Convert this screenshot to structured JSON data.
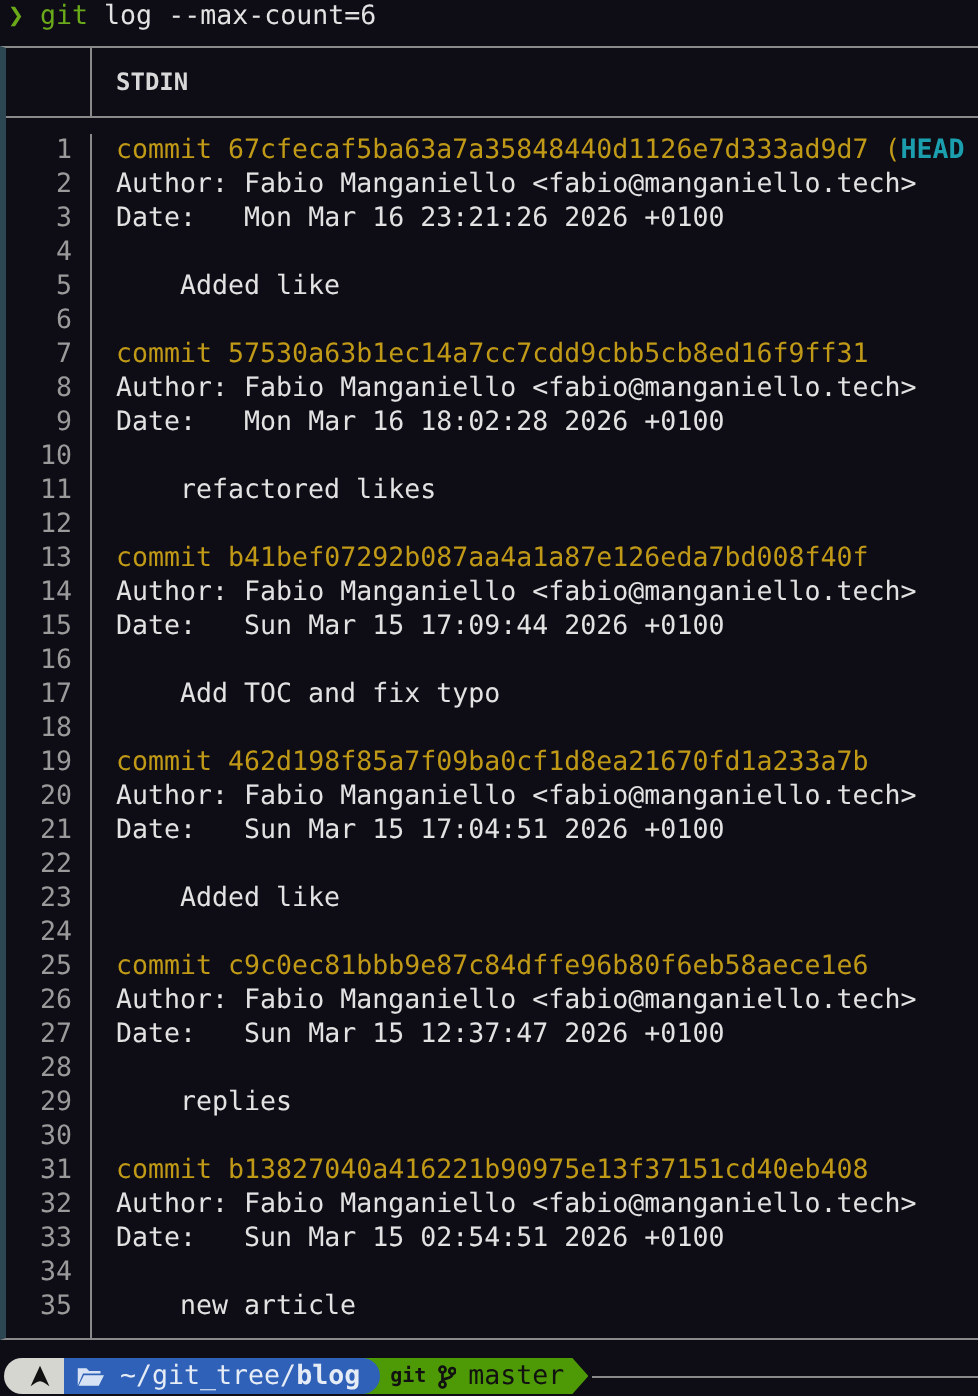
{
  "prompt": {
    "symbol": "❯",
    "command": "git",
    "args": "log --max-count=6"
  },
  "pager": {
    "header": "STDIN",
    "lines": [
      {
        "number": "1",
        "kind": "commit",
        "text": "commit 67cfecaf5ba63a7a35848440d1126e7d333ad9d7 (",
        "head": "HEAD"
      },
      {
        "number": "2",
        "kind": "author",
        "text": "Author: Fabio Manganiello <fabio@manganiello.tech>"
      },
      {
        "number": "3",
        "kind": "date",
        "text": "Date:   Mon Mar 16 23:21:26 2026 +0100"
      },
      {
        "number": "4",
        "kind": "blank"
      },
      {
        "number": "5",
        "kind": "message",
        "text": "Added like"
      },
      {
        "number": "6",
        "kind": "blank"
      },
      {
        "number": "7",
        "kind": "commit",
        "text": "commit 57530a63b1ec14a7cc7cdd9cbb5cb8ed16f9ff31"
      },
      {
        "number": "8",
        "kind": "author",
        "text": "Author: Fabio Manganiello <fabio@manganiello.tech>"
      },
      {
        "number": "9",
        "kind": "date",
        "text": "Date:   Mon Mar 16 18:02:28 2026 +0100"
      },
      {
        "number": "10",
        "kind": "blank"
      },
      {
        "number": "11",
        "kind": "message",
        "text": "refactored likes"
      },
      {
        "number": "12",
        "kind": "blank"
      },
      {
        "number": "13",
        "kind": "commit",
        "text": "commit b41bef07292b087aa4a1a87e126eda7bd008f40f"
      },
      {
        "number": "14",
        "kind": "author",
        "text": "Author: Fabio Manganiello <fabio@manganiello.tech>"
      },
      {
        "number": "15",
        "kind": "date",
        "text": "Date:   Sun Mar 15 17:09:44 2026 +0100"
      },
      {
        "number": "16",
        "kind": "blank"
      },
      {
        "number": "17",
        "kind": "message",
        "text": "Add TOC and fix typo"
      },
      {
        "number": "18",
        "kind": "blank"
      },
      {
        "number": "19",
        "kind": "commit",
        "text": "commit 462d198f85a7f09ba0cf1d8ea21670fd1a233a7b"
      },
      {
        "number": "20",
        "kind": "author",
        "text": "Author: Fabio Manganiello <fabio@manganiello.tech>"
      },
      {
        "number": "21",
        "kind": "date",
        "text": "Date:   Sun Mar 15 17:04:51 2026 +0100"
      },
      {
        "number": "22",
        "kind": "blank"
      },
      {
        "number": "23",
        "kind": "message",
        "text": "Added like"
      },
      {
        "number": "24",
        "kind": "blank"
      },
      {
        "number": "25",
        "kind": "commit",
        "text": "commit c9c0ec81bbb9e87c84dffe96b80f6eb58aece1e6"
      },
      {
        "number": "26",
        "kind": "author",
        "text": "Author: Fabio Manganiello <fabio@manganiello.tech>"
      },
      {
        "number": "27",
        "kind": "date",
        "text": "Date:   Sun Mar 15 12:37:47 2026 +0100"
      },
      {
        "number": "28",
        "kind": "blank"
      },
      {
        "number": "29",
        "kind": "message",
        "text": "replies"
      },
      {
        "number": "30",
        "kind": "blank"
      },
      {
        "number": "31",
        "kind": "commit",
        "text": "commit b13827040a416221b90975e13f37151cd40eb408"
      },
      {
        "number": "32",
        "kind": "author",
        "text": "Author: Fabio Manganiello <fabio@manganiello.tech>"
      },
      {
        "number": "33",
        "kind": "date",
        "text": "Date:   Sun Mar 15 02:54:51 2026 +0100"
      },
      {
        "number": "34",
        "kind": "blank"
      },
      {
        "number": "35",
        "kind": "message",
        "text": "new article"
      }
    ]
  },
  "status_bar": {
    "path": "~/git_tree/**blog**",
    "vcs": "git",
    "branch": "master"
  }
}
